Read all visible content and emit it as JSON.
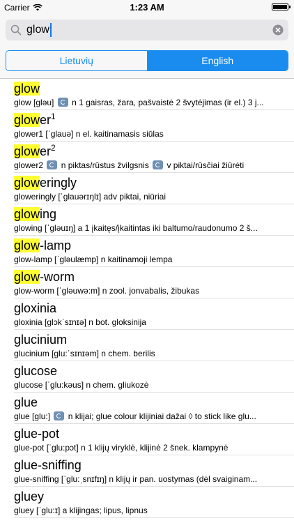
{
  "status": {
    "carrier": "Carrier",
    "time": "1:23 AM"
  },
  "search": {
    "value": "glow"
  },
  "segment": {
    "left": "Lietuvių",
    "right": "English"
  },
  "entries": [
    {
      "pre": "",
      "hl": "glow",
      "rest": "",
      "sup": "",
      "speaker": true,
      "def_a": "glow [gləu]",
      "def_b": "n 1 gaisras, žara, pašvaistė 2 švytėjimas (ir el.) 3 j..."
    },
    {
      "pre": "",
      "hl": "glow",
      "rest": "er",
      "sup": "1",
      "speaker": false,
      "def_a": "glower1 [ˈglauə] n el. kaitinamasis siūlas",
      "def_b": ""
    },
    {
      "pre": "",
      "hl": "glow",
      "rest": "er",
      "sup": "2",
      "speaker": true,
      "def_a": "glower2",
      "def_b": "n piktas/rūstus žvilgsnis",
      "def_c": "v piktai/rūsčiai žiūrėti"
    },
    {
      "pre": "",
      "hl": "glow",
      "rest": "eringly",
      "sup": "",
      "speaker": false,
      "def_a": "gloweringly [ˈglauərɪŋlɪ] adv piktai, niūriai",
      "def_b": ""
    },
    {
      "pre": "",
      "hl": "glow",
      "rest": "ing",
      "sup": "",
      "speaker": false,
      "def_a": "glowing [ˈgləuɪŋ] a 1 įkaitęs/įkaitintas iki baltumo/raudonumo 2 š...",
      "def_b": ""
    },
    {
      "pre": "",
      "hl": "glow",
      "rest": "-lamp",
      "sup": "",
      "speaker": false,
      "def_a": "glow-lamp [ˈgləulæmp] n kaitinamoji lempa",
      "def_b": ""
    },
    {
      "pre": "",
      "hl": "glow",
      "rest": "-worm",
      "sup": "",
      "speaker": false,
      "def_a": "glow-worm [ˈgləuwə:m] n zool. jonvabalis, žibukas",
      "def_b": ""
    },
    {
      "pre": "gloxinia",
      "hl": "",
      "rest": "",
      "sup": "",
      "speaker": false,
      "def_a": "gloxinia [glɔkˈsɪnɪə] n bot. gloksinija",
      "def_b": ""
    },
    {
      "pre": "glucinium",
      "hl": "",
      "rest": "",
      "sup": "",
      "speaker": false,
      "def_a": "glucinium [glu:ˈsɪnɪəm] n chem. berilis",
      "def_b": ""
    },
    {
      "pre": "glucose",
      "hl": "",
      "rest": "",
      "sup": "",
      "speaker": false,
      "def_a": "glucose [ˈglu:kəus] n chem. gliukozė",
      "def_b": ""
    },
    {
      "pre": "glue",
      "hl": "",
      "rest": "",
      "sup": "",
      "speaker": true,
      "def_a": "glue [glu:]",
      "def_b": "n klijai; glue colour klijiniai dažai ◊ to stick like glu..."
    },
    {
      "pre": "glue-pot",
      "hl": "",
      "rest": "",
      "sup": "",
      "speaker": false,
      "def_a": "glue-pot [ˈglu:pɔt] n 1 klijų viryklė, klijinė 2 šnek. klampynė",
      "def_b": ""
    },
    {
      "pre": "glue-sniffing",
      "hl": "",
      "rest": "",
      "sup": "",
      "speaker": false,
      "def_a": "glue-sniffing [ˈglu:ˌsnɪfɪŋ] n klijų ir pan. uostymas (dėl svaiginam...",
      "def_b": ""
    },
    {
      "pre": "gluey",
      "hl": "",
      "rest": "",
      "sup": "",
      "speaker": false,
      "def_a": "gluey [ˈglu:ɪ] a klijingas; lipus, lipnus",
      "def_b": ""
    }
  ]
}
